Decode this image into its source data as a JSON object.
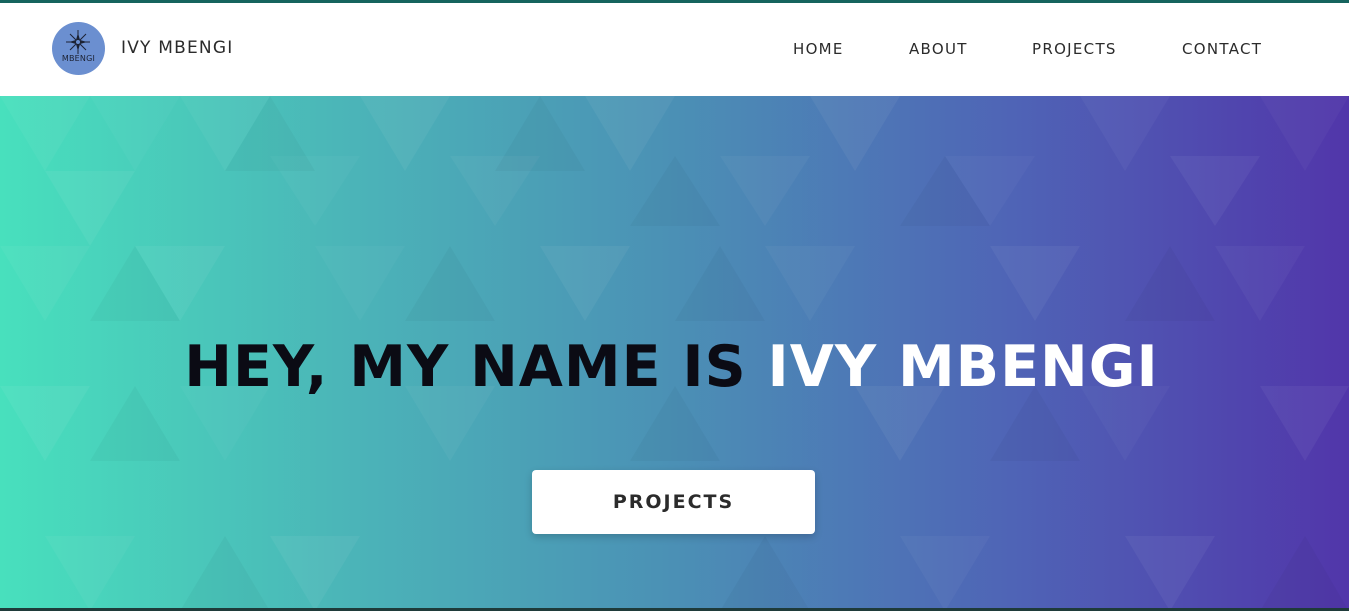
{
  "header": {
    "logo_text": "MBENGI",
    "brand_name": "IVY MBENGI",
    "nav": [
      {
        "label": "HOME"
      },
      {
        "label": "ABOUT"
      },
      {
        "label": "PROJECTS"
      },
      {
        "label": "CONTACT"
      }
    ]
  },
  "hero": {
    "title_prefix": "HEY, MY NAME IS ",
    "title_name": "IVY MBENGI",
    "button_label": "PROJECTS"
  },
  "colors": {
    "header_bg": "#ffffff",
    "gradient_start": "#48e0bd",
    "gradient_end": "#5136aa",
    "title_dark": "#0b0b14",
    "title_light": "#ffffff",
    "logo_bg": "#6b8fd0"
  },
  "icons": {
    "logo": "compass-star-icon"
  }
}
